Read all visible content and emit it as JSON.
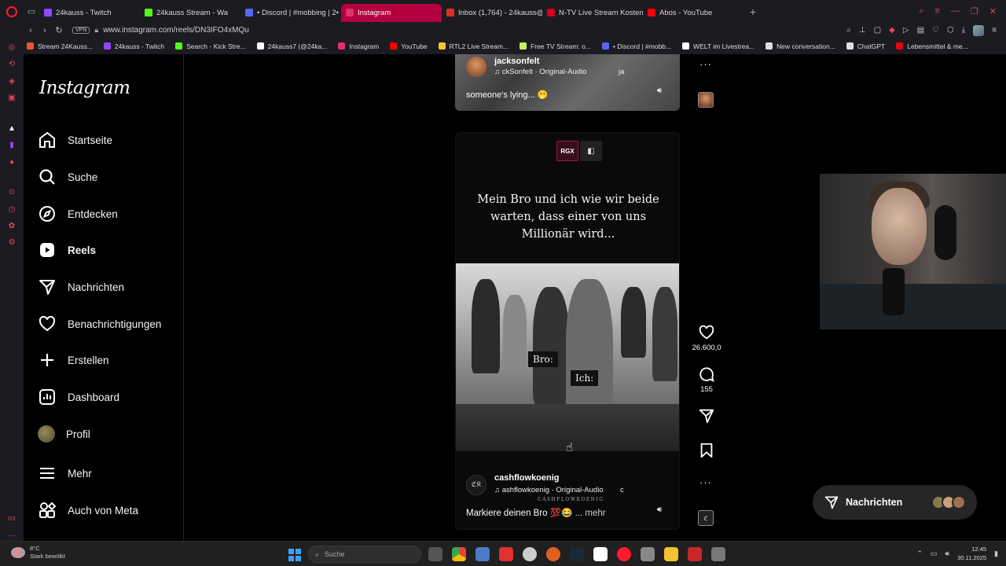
{
  "browser": {
    "tabs": [
      {
        "label": "24kauss - Twitch",
        "color": "#9146ff",
        "active": false
      },
      {
        "label": "24kauss Stream - Wa",
        "color": "#53fc18",
        "active": false
      },
      {
        "label": "• Discord | #mobbing | 2•",
        "color": "#5865f2",
        "active": false
      },
      {
        "label": "Instagram",
        "color": "#e1306c",
        "active": true
      },
      {
        "label": "Inbox (1,764) - 24kauss@",
        "color": "#d93025",
        "active": false
      },
      {
        "label": "N-TV Live Stream Kosten",
        "color": "#d6001c",
        "active": false
      },
      {
        "label": "Abos - YouTube",
        "color": "#ff0000",
        "active": false
      }
    ],
    "url": "www.instagram.com/reels/DN3IFO4xMQu",
    "vpn_label": "VPN",
    "bookmarks": [
      {
        "label": "Stream 24Kauss...",
        "color": "#e8562a"
      },
      {
        "label": "24kauss - Twitch",
        "color": "#9146ff"
      },
      {
        "label": "Search - Kick Stre...",
        "color": "#53fc18"
      },
      {
        "label": "24kauss7 (@24ka...",
        "color": "#ffffff"
      },
      {
        "label": "Instagram",
        "color": "#e1306c"
      },
      {
        "label": "YouTube",
        "color": "#ff0000"
      },
      {
        "label": "RTL2 Live Stream...",
        "color": "#f4c430"
      },
      {
        "label": "Free TV Stream: o...",
        "color": "#c8f25c"
      },
      {
        "label": "• Discord | #mobb...",
        "color": "#5865f2"
      },
      {
        "label": "WELT im Livestrea...",
        "color": "#ffffff"
      },
      {
        "label": "New conversation...",
        "color": "#dddddd"
      },
      {
        "label": "ChatGPT",
        "color": "#dddddd"
      },
      {
        "label": "Lebensmittel & me...",
        "color": "#e30613"
      }
    ]
  },
  "instagram": {
    "logo": "Instagram",
    "nav": [
      {
        "key": "home",
        "label": "Startseite"
      },
      {
        "key": "search",
        "label": "Suche"
      },
      {
        "key": "explore",
        "label": "Entdecken"
      },
      {
        "key": "reels",
        "label": "Reels"
      },
      {
        "key": "messages",
        "label": "Nachrichten"
      },
      {
        "key": "notifications",
        "label": "Benachrichtigungen"
      },
      {
        "key": "create",
        "label": "Erstellen"
      },
      {
        "key": "dashboard",
        "label": "Dashboard"
      },
      {
        "key": "profile",
        "label": "Profil"
      },
      {
        "key": "more",
        "label": "Mehr"
      },
      {
        "key": "meta",
        "label": "Auch von Meta"
      }
    ],
    "prev_reel": {
      "username": "jacksonfelt",
      "audio": "ckSonfelt · Original-Audio",
      "audio_extra": "ja",
      "caption": "someone's lying... 🫢"
    },
    "reel": {
      "badge": "RGX",
      "meme_text": "Mein Bro und ich wie wir beide warten, dass einer von uns Millionär wird...",
      "bubble_bro": "Bro:",
      "bubble_ich": "Ich:",
      "username": "cashflowkoenig",
      "avatar_text": "ℭ𝔎",
      "audio": "ashflowkoenig · Original-Audio",
      "audio_extra": "c",
      "watermark": "CASHFLOWKOENIG",
      "caption": "Markiere deinen Bro 💯😂",
      "more": "... mehr",
      "likes": "26.600,0",
      "comments": "155"
    },
    "messages_pill": "Nachrichten"
  },
  "taskbar": {
    "weather_temp": "8°C",
    "weather_desc": "Stark bewölkt",
    "search_placeholder": "Suche",
    "time": "12:45",
    "date": "30.11.2025"
  }
}
